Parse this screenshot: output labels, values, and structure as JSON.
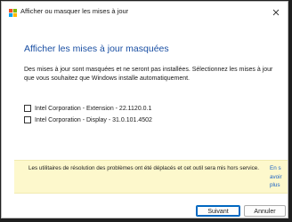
{
  "window": {
    "title": "Afficher ou masquer les mises à jour",
    "icon": "windows-logo-icon",
    "close_icon": "close-icon"
  },
  "content": {
    "heading": "Afficher les mises à jour masquées",
    "description": "Des mises à jour sont masquées et ne seront pas installées. Sélectionnez les mises à jour que vous souhaitez que Windows installe automatiquement.",
    "updates": [
      {
        "label": "Intel Corporation - Extension - 22.1120.0.1",
        "checked": false
      },
      {
        "label": "Intel Corporation - Display - 31.0.101.4502",
        "checked": false
      }
    ]
  },
  "notice": {
    "text": "Les utilitaires de résolution des problèmes ont été déplacés et cet outil sera mis hors service.",
    "link": "En savoir plus"
  },
  "buttons": {
    "next": "Suivant",
    "cancel": "Annuler"
  },
  "colors": {
    "heading": "#1a4fa3",
    "notice_bg": "#fdf8cc",
    "link": "#1a62c4",
    "primary_border": "#0067c0"
  }
}
